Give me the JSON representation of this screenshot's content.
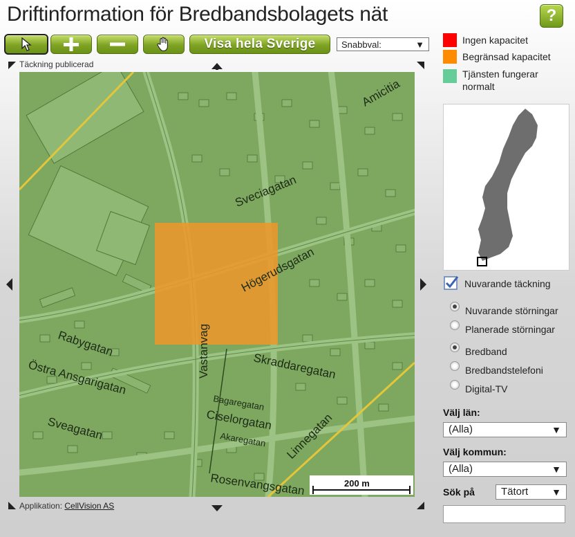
{
  "header": {
    "title": "Driftinformation för Bredbandsbolagets nät",
    "help_label": "?"
  },
  "toolbar": {
    "visa_label": "Visa hela Sverige",
    "snabbval_label": "Snabbval:"
  },
  "map": {
    "coverage_label": "Täckning publicerad",
    "app_prefix": "Applikation:",
    "app_link": "CellVision AS",
    "scale_label": "200 m",
    "overlay_color": "#f0962a",
    "streets": [
      "Sveciagatan",
      "Högerudsgatan",
      "Rabygatan",
      "Östra Ansgarigatan",
      "Sveagatan",
      "Vastanvag",
      "Skraddaregatan",
      "Ciselorgatan",
      "Rosenvangsgatan",
      "Linnegatan",
      "Amicitia",
      "Bagaregatan",
      "Akaregatan"
    ]
  },
  "legend": [
    {
      "label": "Ingen kapacitet",
      "color": "#ff0000"
    },
    {
      "label": "Begränsad kapacitet",
      "color": "#ff8c00"
    },
    {
      "label": "Tjänsten fungerar normalt",
      "color": "#66cc99"
    }
  ],
  "panel": {
    "coverage_checkbox": "Nuvarande täckning",
    "disturbance_options": [
      {
        "label": "Nuvarande störningar",
        "checked": true
      },
      {
        "label": "Planerade störningar",
        "checked": false
      }
    ],
    "service_options": [
      {
        "label": "Bredband",
        "checked": true
      },
      {
        "label": "Bredbandstelefoni",
        "checked": false
      },
      {
        "label": "Digital-TV",
        "checked": false
      }
    ],
    "lan_label": "Välj län:",
    "lan_value": "(Alla)",
    "kommun_label": "Välj kommun:",
    "kommun_value": "(Alla)",
    "search_label": "Sök på",
    "search_type": "Tätort",
    "search_value": ""
  }
}
